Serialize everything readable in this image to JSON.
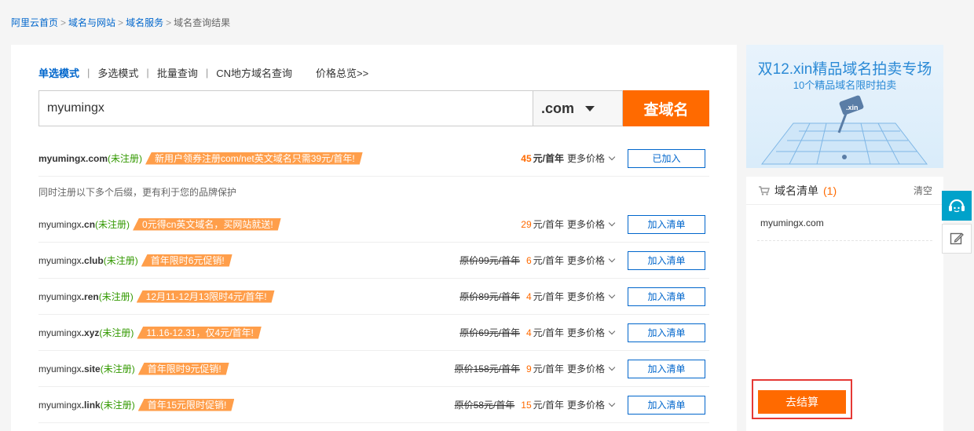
{
  "breadcrumb": {
    "items": [
      "阿里云首页",
      "域名与网站",
      "域名服务"
    ],
    "current": "域名查询结果",
    "sep": ">"
  },
  "modes": {
    "items": [
      "单选模式",
      "多选模式",
      "批量查询",
      "CN地方域名查询"
    ],
    "divider": "|",
    "price_link": "价格总览>>"
  },
  "search": {
    "value": "myumingx",
    "tld": ".com",
    "button": "查域名"
  },
  "common": {
    "registered_status": "(未注册)",
    "more_prices": "更多价格",
    "per_year": "元/首年"
  },
  "results": [
    {
      "prefix": "myumingx",
      "tld": ".com",
      "promo": "新用户领券注册com/net英文域名只需39元/首年!",
      "orig": "",
      "price": "45",
      "action": "已加入",
      "bold_all": true
    },
    {
      "prefix": "myumingx",
      "tld": ".cn",
      "promo": "0元得cn英文域名，买网站就送!",
      "orig": "",
      "price": "29",
      "action": "加入清单"
    },
    {
      "prefix": "myumingx",
      "tld": ".club",
      "promo": "首年限时6元促销!",
      "orig": "原价99元/首年",
      "price": "6",
      "action": "加入清单"
    },
    {
      "prefix": "myumingx",
      "tld": ".ren",
      "promo": "12月11-12月13限时4元/首年!",
      "orig": "原价89元/首年",
      "price": "4",
      "action": "加入清单"
    },
    {
      "prefix": "myumingx",
      "tld": ".xyz",
      "promo": "11.16-12.31，仅4元/首年!",
      "orig": "原价69元/首年",
      "price": "4",
      "action": "加入清单"
    },
    {
      "prefix": "myumingx",
      "tld": ".site",
      "promo": "首年限时9元促销!",
      "orig": "原价158元/首年",
      "price": "9",
      "action": "加入清单"
    },
    {
      "prefix": "myumingx",
      "tld": ".link",
      "promo": "首年15元限时促销!",
      "orig": "原价58元/首年",
      "price": "15",
      "action": "加入清单"
    }
  ],
  "note": "同时注册以下多个后缀，更有利于您的品牌保护",
  "banner": {
    "title": "双12.xin精品域名拍卖专场",
    "subtitle": "10个精品域名限时拍卖",
    "hammer_label": ".xin"
  },
  "cart": {
    "title": "域名清单",
    "count": "(1)",
    "clear": "清空",
    "items": [
      "myumingx.com"
    ],
    "checkout": "去结算"
  },
  "colors": {
    "accent": "#ff6a00",
    "link": "#0066cc",
    "promo": "#ff9e4a",
    "available": "#339900",
    "highlight_frame": "#e53935"
  }
}
